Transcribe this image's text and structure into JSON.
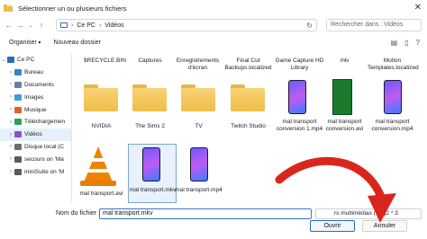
{
  "window": {
    "title": "Sélectionner un ou plusieurs fichiers",
    "close": "✕"
  },
  "nav": {
    "back": "←",
    "forward": "→",
    "up": "↑"
  },
  "address": {
    "segments": [
      "Ce PC",
      "Vidéos"
    ],
    "separator": "›",
    "refresh": "↻"
  },
  "search": {
    "placeholder": "Rechercher dans : Vidéos"
  },
  "toolbar": {
    "organiser": "Organiser",
    "new_folder": "Nouveau dossier"
  },
  "sidebar": {
    "items": [
      {
        "label": "Ce PC",
        "chevron": "⌄",
        "icon": "computer-icon",
        "color": "#2b6cb0"
      },
      {
        "label": "Bureau",
        "chevron": "›",
        "icon": "desktop-icon",
        "color": "#3b82c4"
      },
      {
        "label": "Documents",
        "chevron": "›",
        "icon": "documents-icon",
        "color": "#6b7fa6"
      },
      {
        "label": "Images",
        "chevron": "›",
        "icon": "images-icon",
        "color": "#3aa0d8"
      },
      {
        "label": "Musique",
        "chevron": "›",
        "icon": "music-icon",
        "color": "#e0612b"
      },
      {
        "label": "Téléchargemen",
        "chevron": "›",
        "icon": "downloads-icon",
        "color": "#2ba05a"
      },
      {
        "label": "Vidéos",
        "chevron": "›",
        "icon": "videos-icon",
        "color": "#8a4fd0"
      },
      {
        "label": "Disque local (C",
        "chevron": "›",
        "icon": "drive-icon",
        "color": "#6d6d6d"
      },
      {
        "label": "secours on 'Ma",
        "chevron": "›",
        "icon": "network-drive-icon",
        "color": "#5a5a5a"
      },
      {
        "label": "miniSuite on 'M",
        "chevron": "›",
        "icon": "network-drive-icon",
        "color": "#5a5a5a"
      }
    ]
  },
  "files": [
    {
      "label": "$RECYCLE.BIN",
      "kind": "folder-label-only"
    },
    {
      "label": "Captures",
      "kind": "folder-label-only"
    },
    {
      "label": "Enregistrements d'écran",
      "kind": "folder-label-only"
    },
    {
      "label": "Final Cut Backups.localized",
      "kind": "folder-label-only"
    },
    {
      "label": "Game Capture HD Library",
      "kind": "folder-label-only"
    },
    {
      "label": "mlv",
      "kind": "folder-label-only"
    },
    {
      "label": "Motion Templates.localized",
      "kind": "folder-label-only"
    },
    {
      "label": "NVIDIA",
      "kind": "folder"
    },
    {
      "label": "The Sims 2",
      "kind": "folder"
    },
    {
      "label": "TV",
      "kind": "folder"
    },
    {
      "label": "Twitch Studio",
      "kind": "folder"
    },
    {
      "label": "mal transport conversion 1.mp4",
      "kind": "video-phone"
    },
    {
      "label": "mal transport conversion.avi",
      "kind": "video-green"
    },
    {
      "label": "mal transport conversion.mp4",
      "kind": "video-phone"
    },
    {
      "label": "mal transport.avi",
      "kind": "vlc"
    },
    {
      "label": "mal transport.mkv",
      "kind": "video-phone-selected"
    },
    {
      "label": "mal transport.mp4",
      "kind": "video-phone"
    }
  ],
  "bottom": {
    "file_name_label": "Nom du fichier :",
    "file_name_value": "mal transport.mkv",
    "file_type": "rs multimédias (*.3g2 *.3",
    "open": "Ouvrir",
    "cancel": "Annuler"
  },
  "colors": {
    "accent": "#2b6cb0",
    "folder": "#f0bd48",
    "arrow": "#d9261c"
  }
}
